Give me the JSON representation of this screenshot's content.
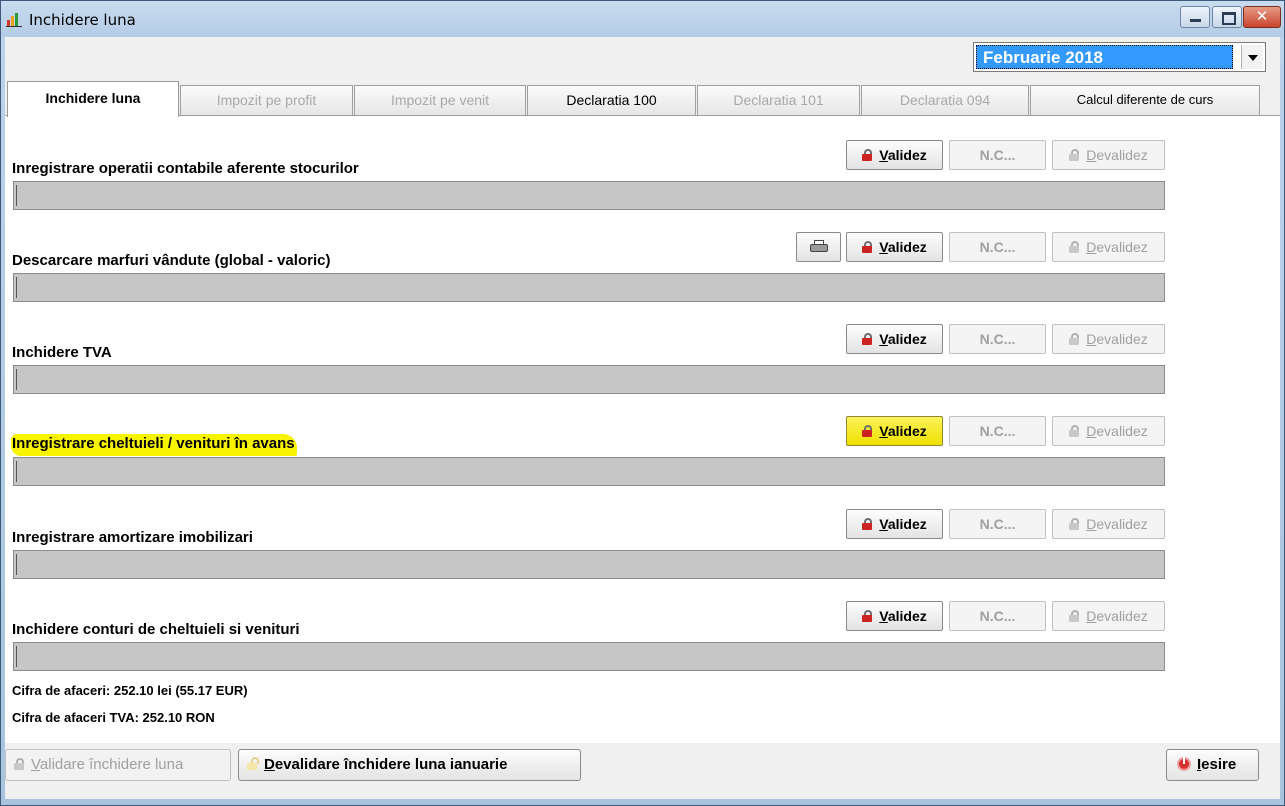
{
  "window": {
    "title": "Inchidere luna"
  },
  "month_selector": {
    "value": "Februarie  2018"
  },
  "tabs": [
    {
      "label": "Inchidere luna",
      "state": "active"
    },
    {
      "label": "Impozit pe profit",
      "state": "disabled"
    },
    {
      "label": "Impozit pe venit",
      "state": "disabled"
    },
    {
      "label": "Declaratia 100",
      "state": "enabled"
    },
    {
      "label": "Declaratia 101",
      "state": "disabled"
    },
    {
      "label": "Declaratia 094",
      "state": "disabled"
    },
    {
      "label": "Calcul diferente de curs",
      "state": "enabled"
    }
  ],
  "buttons": {
    "validez_u": "V",
    "validez_rest": "alidez",
    "nc": "N.C...",
    "devalidez_u": "D",
    "devalidez_rest": "evalidez"
  },
  "sections": [
    {
      "title": "Inregistrare operatii contabile aferente stocurilor",
      "highlighted": false,
      "has_print": false
    },
    {
      "title": "Descarcare marfuri vândute (global - valoric)",
      "highlighted": false,
      "has_print": true
    },
    {
      "title": "Inchidere TVA",
      "highlighted": false,
      "has_print": false
    },
    {
      "title": "Inregistrare cheltuieli / venituri în avans",
      "highlighted": true,
      "has_print": false
    },
    {
      "title": "Inregistrare amortizare imobilizari",
      "highlighted": false,
      "has_print": false
    },
    {
      "title": "Inchidere conturi de cheltuieli si venituri",
      "highlighted": false,
      "has_print": false
    }
  ],
  "info": {
    "cifra_afaceri": "Cifra de afaceri: 252.10 lei (55.17 EUR)",
    "cifra_afaceri_tva": "Cifra de afaceri TVA: 252.10 RON"
  },
  "bottom": {
    "validare_u": "V",
    "validare_rest": "alidare închidere luna",
    "devalidare_u": "D",
    "devalidare_rest": "evalidare închidere luna ianuarie",
    "iesire_u": "I",
    "iesire_rest": "esire"
  },
  "colors": {
    "highlight": "#f8f400",
    "selection": "#3399ff",
    "lock_red": "#cc2222"
  },
  "icons": [
    "app-chart-icon",
    "minimize-icon",
    "maximize-icon",
    "close-icon",
    "dropdown-arrow-icon",
    "lock-icon",
    "unlock-icon",
    "printer-icon",
    "power-icon"
  ]
}
